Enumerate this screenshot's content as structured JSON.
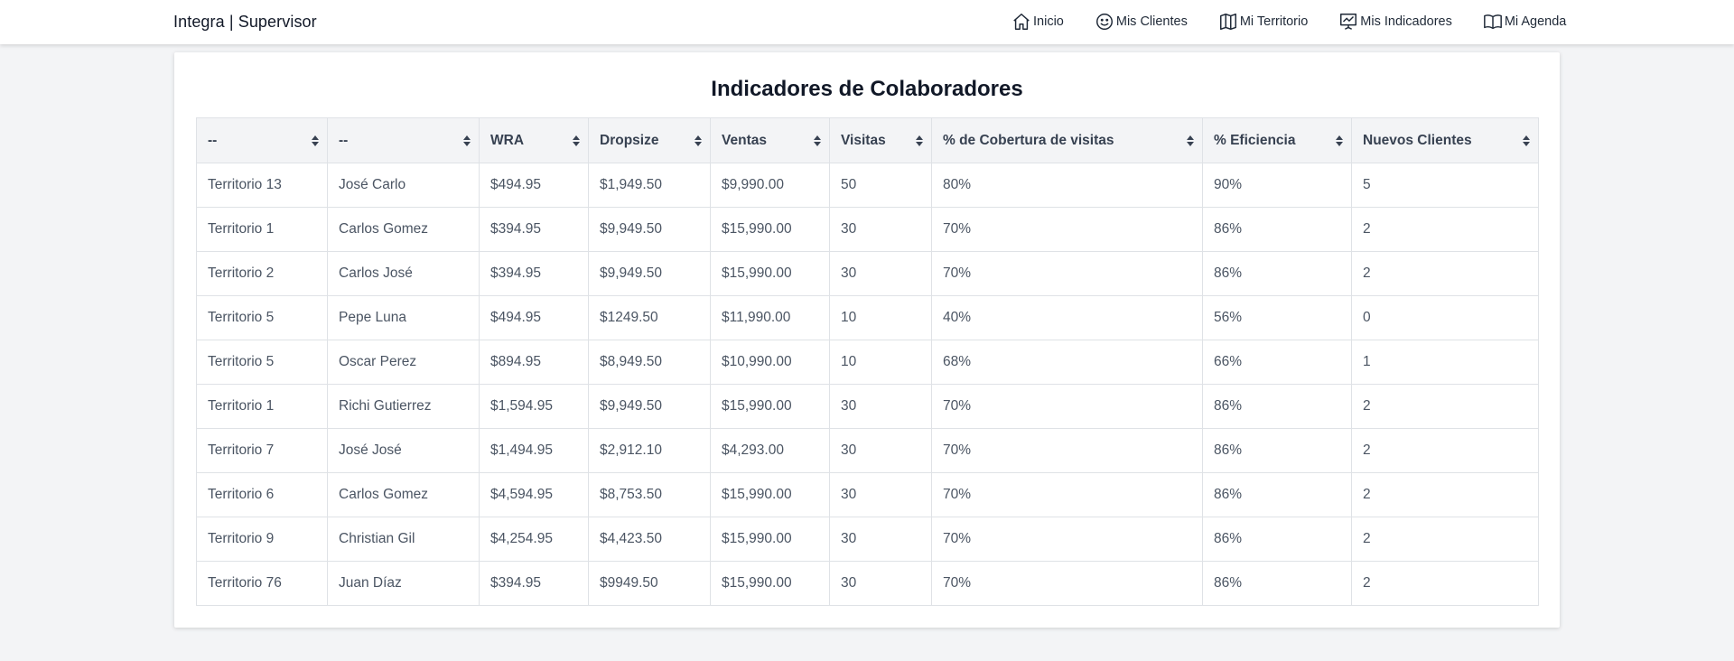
{
  "navbar": {
    "brand": "Integra | Supervisor",
    "links": [
      {
        "label": "Inicio",
        "icon": "home-icon"
      },
      {
        "label": "Mis Clientes",
        "icon": "smiley-icon"
      },
      {
        "label": "Mi Territorio",
        "icon": "map-icon"
      },
      {
        "label": "Mis Indicadores",
        "icon": "chart-board-icon"
      },
      {
        "label": "Mi Agenda",
        "icon": "book-icon"
      }
    ]
  },
  "card": {
    "title": "Indicadores de Colaboradores"
  },
  "table": {
    "headers": [
      "--",
      "--",
      "WRA",
      "Dropsize",
      "Ventas",
      "Visitas",
      "% de Cobertura de visitas",
      "% Eficiencia",
      "Nuevos Clientes"
    ],
    "rows": [
      [
        "Territorio 13",
        "José Carlo",
        "$494.95",
        "$1,949.50",
        "$9,990.00",
        "50",
        "80%",
        "90%",
        "5"
      ],
      [
        "Territorio 1",
        "Carlos Gomez",
        "$394.95",
        "$9,949.50",
        "$15,990.00",
        "30",
        "70%",
        "86%",
        "2"
      ],
      [
        "Territorio 2",
        "Carlos José",
        "$394.95",
        "$9,949.50",
        "$15,990.00",
        "30",
        "70%",
        "86%",
        "2"
      ],
      [
        "Territorio 5",
        "Pepe Luna",
        "$494.95",
        "$1249.50",
        "$11,990.00",
        "10",
        "40%",
        "56%",
        "0"
      ],
      [
        "Territorio 5",
        "Oscar Perez",
        "$894.95",
        "$8,949.50",
        "$10,990.00",
        "10",
        "68%",
        "66%",
        "1"
      ],
      [
        "Territorio 1",
        "Richi Gutierrez",
        "$1,594.95",
        "$9,949.50",
        "$15,990.00",
        "30",
        "70%",
        "86%",
        "2"
      ],
      [
        "Territorio 7",
        "José José",
        "$1,494.95",
        "$2,912.10",
        "$4,293.00",
        "30",
        "70%",
        "86%",
        "2"
      ],
      [
        "Territorio 6",
        "Carlos Gomez",
        "$4,594.95",
        "$8,753.50",
        "$15,990.00",
        "30",
        "70%",
        "86%",
        "2"
      ],
      [
        "Territorio 9",
        "Christian Gil",
        "$4,254.95",
        "$4,423.50",
        "$15,990.00",
        "30",
        "70%",
        "86%",
        "2"
      ],
      [
        "Territorio 76",
        "Juan Díaz",
        "$394.95",
        "$9949.50",
        "$15,990.00",
        "30",
        "70%",
        "86%",
        "2"
      ]
    ]
  }
}
